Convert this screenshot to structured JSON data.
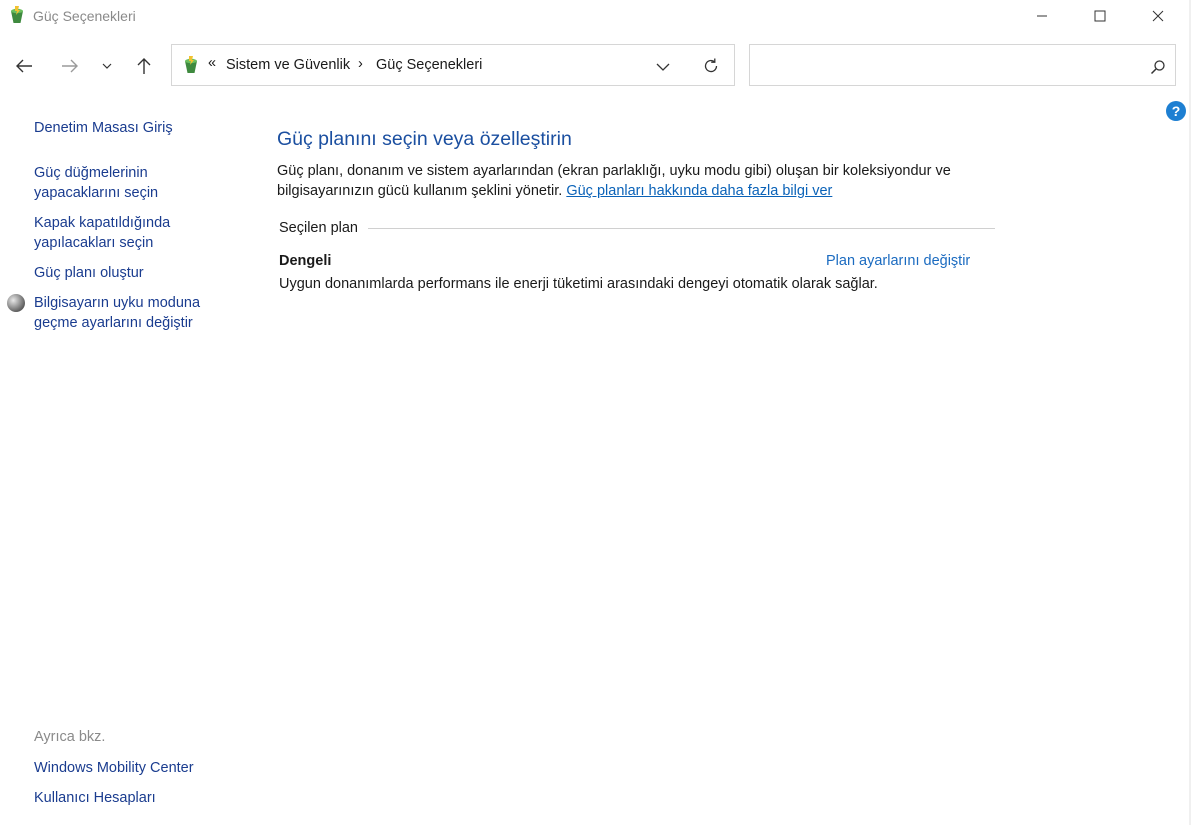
{
  "window": {
    "title": "Güç Seçenekleri",
    "minimize_icon": "minimize-icon",
    "maximize_icon": "maximize-icon",
    "close_icon": "close-icon"
  },
  "nav": {
    "back_icon": "arrow-left-icon",
    "forward_icon": "arrow-right-icon",
    "recent_icon": "chevron-down-icon",
    "up_icon": "arrow-up-icon",
    "breadcrumb_overflow": "«",
    "breadcrumb": [
      "Sistem ve Güvenlik",
      "Güç Seçenekleri"
    ],
    "separator": "›",
    "search_placeholder": ""
  },
  "sidebar": {
    "home": "Denetim Masası Giriş",
    "items": [
      "Güç düğmelerinin yapacaklarını seçin",
      "Kapak kapatıldığında yapılacakları seçin",
      "Güç planı oluştur",
      "Bilgisayarın uyku moduna geçme ayarlarını değiştir"
    ],
    "see_also_label": "Ayrıca bkz.",
    "see_also": [
      "Windows Mobility Center",
      "Kullanıcı Hesapları"
    ]
  },
  "main": {
    "heading": "Güç planını seçin veya özelleştirin",
    "desc_line1": "Güç planı, donanım ve sistem ayarlarından (ekran parlaklığı, uyku modu gibi) oluşan bir koleksiyondur ve",
    "desc_line2": "bilgisayarınızın gücü kullanım şeklini yönetir.",
    "desc_link": "Güç planları hakkında daha fazla bilgi ver",
    "section_label": "Seçilen plan",
    "plan_name": "Dengeli",
    "plan_link": "Plan ayarlarını değiştir",
    "plan_desc": "Uygun donanımlarda performans ile enerji tüketimi arasındaki dengeyi otomatik olarak sağlar."
  },
  "help_label": "?",
  "colors": {
    "accent": "#1b4fa0",
    "link": "#0a62b8",
    "help_bg": "#1d7fd2"
  }
}
